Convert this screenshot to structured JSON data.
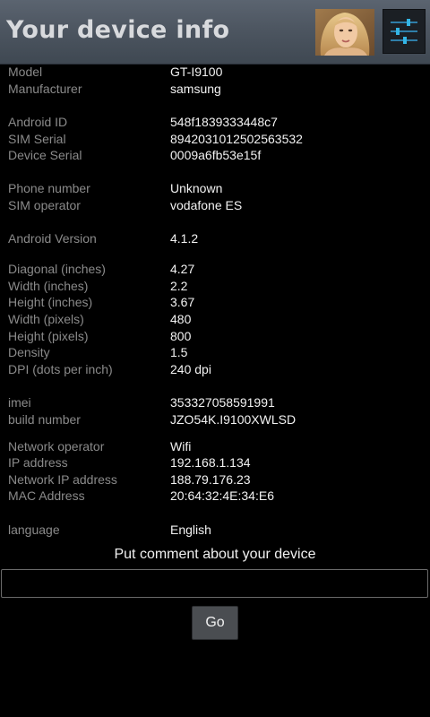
{
  "header": {
    "title": "Your device info",
    "avatar_icon": "profile-photo",
    "settings_icon": "sliders-icon",
    "bar_color": "#4d5661"
  },
  "info_rows": [
    {
      "label": "Model",
      "value": "GT-I9100"
    },
    {
      "label": "Manufacturer",
      "value": "samsung"
    },
    {
      "label": "Android ID",
      "value": "548f1839333448c7"
    },
    {
      "label": "SIM Serial",
      "value": "8942031012502563532"
    },
    {
      "label": "Device Serial",
      "value": "0009a6fb53e15f"
    },
    {
      "label": "Phone number",
      "value": "Unknown"
    },
    {
      "label": "SIM operator",
      "value": "vodafone ES"
    },
    {
      "label": "Android Version",
      "value": "4.1.2"
    },
    {
      "label": "Diagonal (inches)",
      "value": "4.27"
    },
    {
      "label": "Width (inches)",
      "value": "2.2"
    },
    {
      "label": "Height (inches)",
      "value": "3.67"
    },
    {
      "label": "Width (pixels)",
      "value": "480"
    },
    {
      "label": "Height (pixels)",
      "value": "800"
    },
    {
      "label": "Density",
      "value": "1.5"
    },
    {
      "label": "DPI (dots per inch)",
      "value": "240 dpi"
    },
    {
      "label": "imei",
      "value": "353327058591991"
    },
    {
      "label": "build number",
      "value": "JZO54K.I9100XWLSD"
    },
    {
      "label": "Network operator",
      "value": "Wifi"
    },
    {
      "label": "IP address",
      "value": "192.168.1.134"
    },
    {
      "label": "Network IP address",
      "value": "188.79.176.23"
    },
    {
      "label": "MAC Address",
      "value": "20:64:32:4E:34:E6"
    },
    {
      "label": "language",
      "value": "English"
    }
  ],
  "comment": {
    "prompt": "Put comment about your device",
    "input_value": "",
    "input_placeholder": "",
    "submit_label": "Go"
  }
}
